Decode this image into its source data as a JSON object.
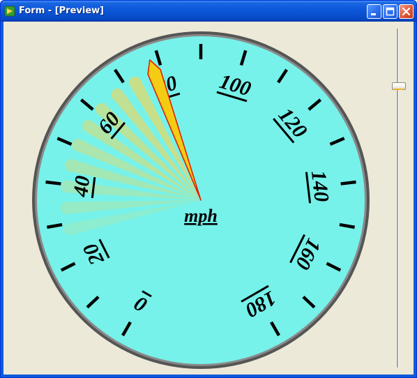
{
  "window": {
    "title": "Form - [Preview]"
  },
  "gauge": {
    "unit_label": "mph",
    "value": 78,
    "min": 0,
    "max": 180,
    "tick_labels": [
      "0",
      "20",
      "40",
      "60",
      "80",
      "100",
      "120",
      "140",
      "160",
      "180"
    ]
  },
  "slider": {
    "value_fraction": 0.1
  },
  "colors": {
    "dial_face": "#76f2ea",
    "dial_rim": "#8a8a8a",
    "needle": "#f5cc14",
    "needle_outline": "#e02000",
    "trail": "#ffd24a",
    "text": "#000000"
  }
}
